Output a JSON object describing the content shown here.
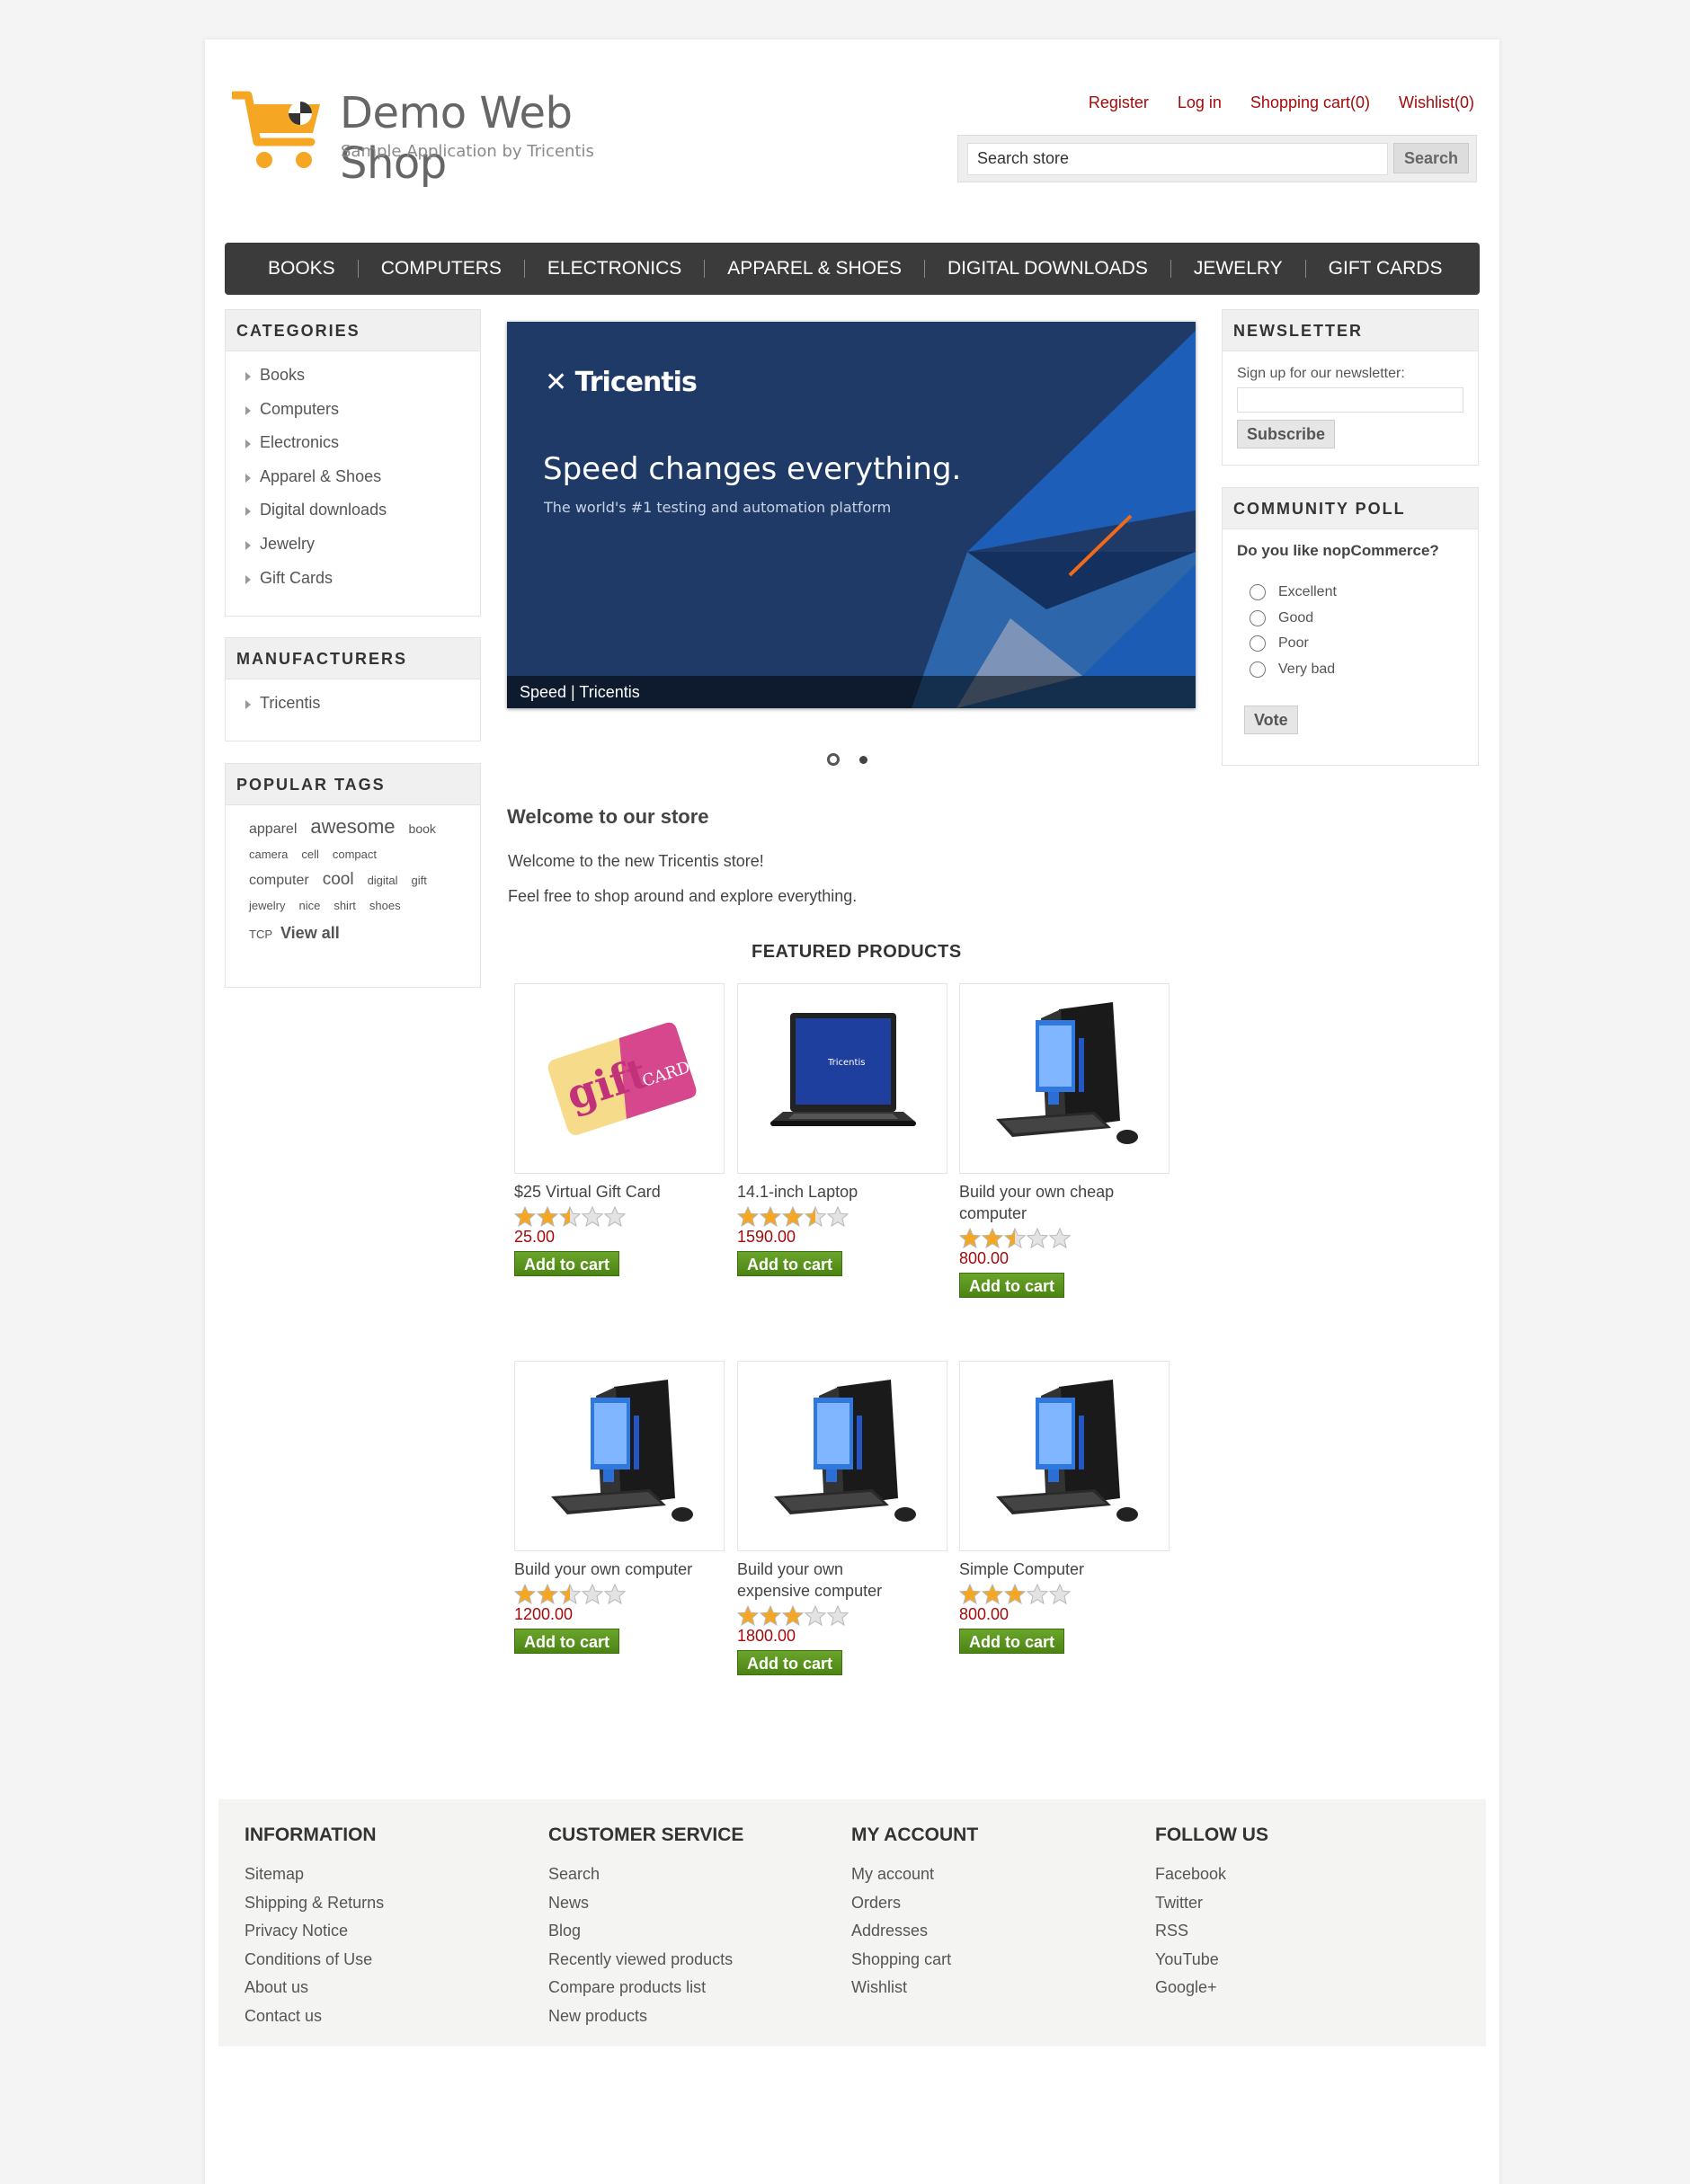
{
  "header": {
    "logo_title": "Demo Web Shop",
    "logo_subtitle": "Sample Application by Tricentis",
    "links": [
      "Register",
      "Log in",
      "Shopping cart(0)",
      "Wishlist(0)"
    ],
    "search_value": "Search store",
    "search_button": "Search"
  },
  "menu": [
    "BOOKS",
    "COMPUTERS",
    "ELECTRONICS",
    "APPAREL & SHOES",
    "DIGITAL DOWNLOADS",
    "JEWELRY",
    "GIFT CARDS"
  ],
  "categories": {
    "title": "CATEGORIES",
    "items": [
      "Books",
      "Computers",
      "Electronics",
      "Apparel & Shoes",
      "Digital downloads",
      "Jewelry",
      "Gift Cards"
    ]
  },
  "manufacturers": {
    "title": "MANUFACTURERS",
    "items": [
      "Tricentis"
    ]
  },
  "tags": {
    "title": "POPULAR TAGS",
    "items": [
      {
        "t": "apparel",
        "s": 16
      },
      {
        "t": "awesome",
        "s": 22
      },
      {
        "t": "book",
        "s": 14
      },
      {
        "t": "camera",
        "s": 13
      },
      {
        "t": "cell",
        "s": 13
      },
      {
        "t": "compact",
        "s": 13
      },
      {
        "t": "computer",
        "s": 16
      },
      {
        "t": "cool",
        "s": 19
      },
      {
        "t": "digital",
        "s": 13
      },
      {
        "t": "gift",
        "s": 13
      },
      {
        "t": "jewelry",
        "s": 13
      },
      {
        "t": "nice",
        "s": 13
      },
      {
        "t": "shirt",
        "s": 13
      },
      {
        "t": "shoes",
        "s": 13
      },
      {
        "t": "TCP",
        "s": 13
      }
    ],
    "view_all": "View all"
  },
  "slider": {
    "brand": "Tricentis",
    "headline": "Speed changes everything.",
    "subline": "The world's #1 testing and automation platform",
    "caption": "Speed | Tricentis"
  },
  "welcome": {
    "title": "Welcome to our store",
    "p1": "Welcome to the new Tricentis store!",
    "p2": "Feel free to shop around and explore everything."
  },
  "featured": {
    "title": "FEATURED PRODUCTS",
    "add_label": "Add to cart",
    "products": [
      {
        "name": "$25 Virtual Gift Card",
        "price": "25.00",
        "rating": 2.5,
        "img": "gift-card"
      },
      {
        "name": "14.1-inch Laptop",
        "price": "1590.00",
        "rating": 3.5,
        "img": "laptop"
      },
      {
        "name": "Build your own cheap computer",
        "price": "800.00",
        "rating": 2.5,
        "img": "desktop"
      },
      {
        "name": "Build your own computer",
        "price": "1200.00",
        "rating": 2.5,
        "img": "desktop"
      },
      {
        "name": "Build your own expensive computer",
        "price": "1800.00",
        "rating": 3,
        "img": "desktop"
      },
      {
        "name": "Simple Computer",
        "price": "800.00",
        "rating": 3,
        "img": "desktop"
      }
    ]
  },
  "newsletter": {
    "title": "NEWSLETTER",
    "label": "Sign up for our newsletter:",
    "button": "Subscribe"
  },
  "poll": {
    "title": "COMMUNITY POLL",
    "question": "Do you like nopCommerce?",
    "options": [
      "Excellent",
      "Good",
      "Poor",
      "Very bad"
    ],
    "button": "Vote"
  },
  "footer": {
    "columns": [
      {
        "title": "INFORMATION",
        "links": [
          "Sitemap",
          "Shipping & Returns",
          "Privacy Notice",
          "Conditions of Use",
          "About us",
          "Contact us"
        ]
      },
      {
        "title": "CUSTOMER SERVICE",
        "links": [
          "Search",
          "News",
          "Blog",
          "Recently viewed products",
          "Compare products list",
          "New products"
        ]
      },
      {
        "title": "MY ACCOUNT",
        "links": [
          "My account",
          "Orders",
          "Addresses",
          "Shopping cart",
          "Wishlist"
        ]
      },
      {
        "title": "FOLLOW US",
        "links": [
          "Facebook",
          "Twitter",
          "RSS",
          "YouTube",
          "Google+"
        ]
      }
    ]
  },
  "colors": {
    "accent": "#a30b0b",
    "menu_bg": "#3b3b3b",
    "cart_green": "#5c9a1b",
    "star": "#f5a623"
  }
}
